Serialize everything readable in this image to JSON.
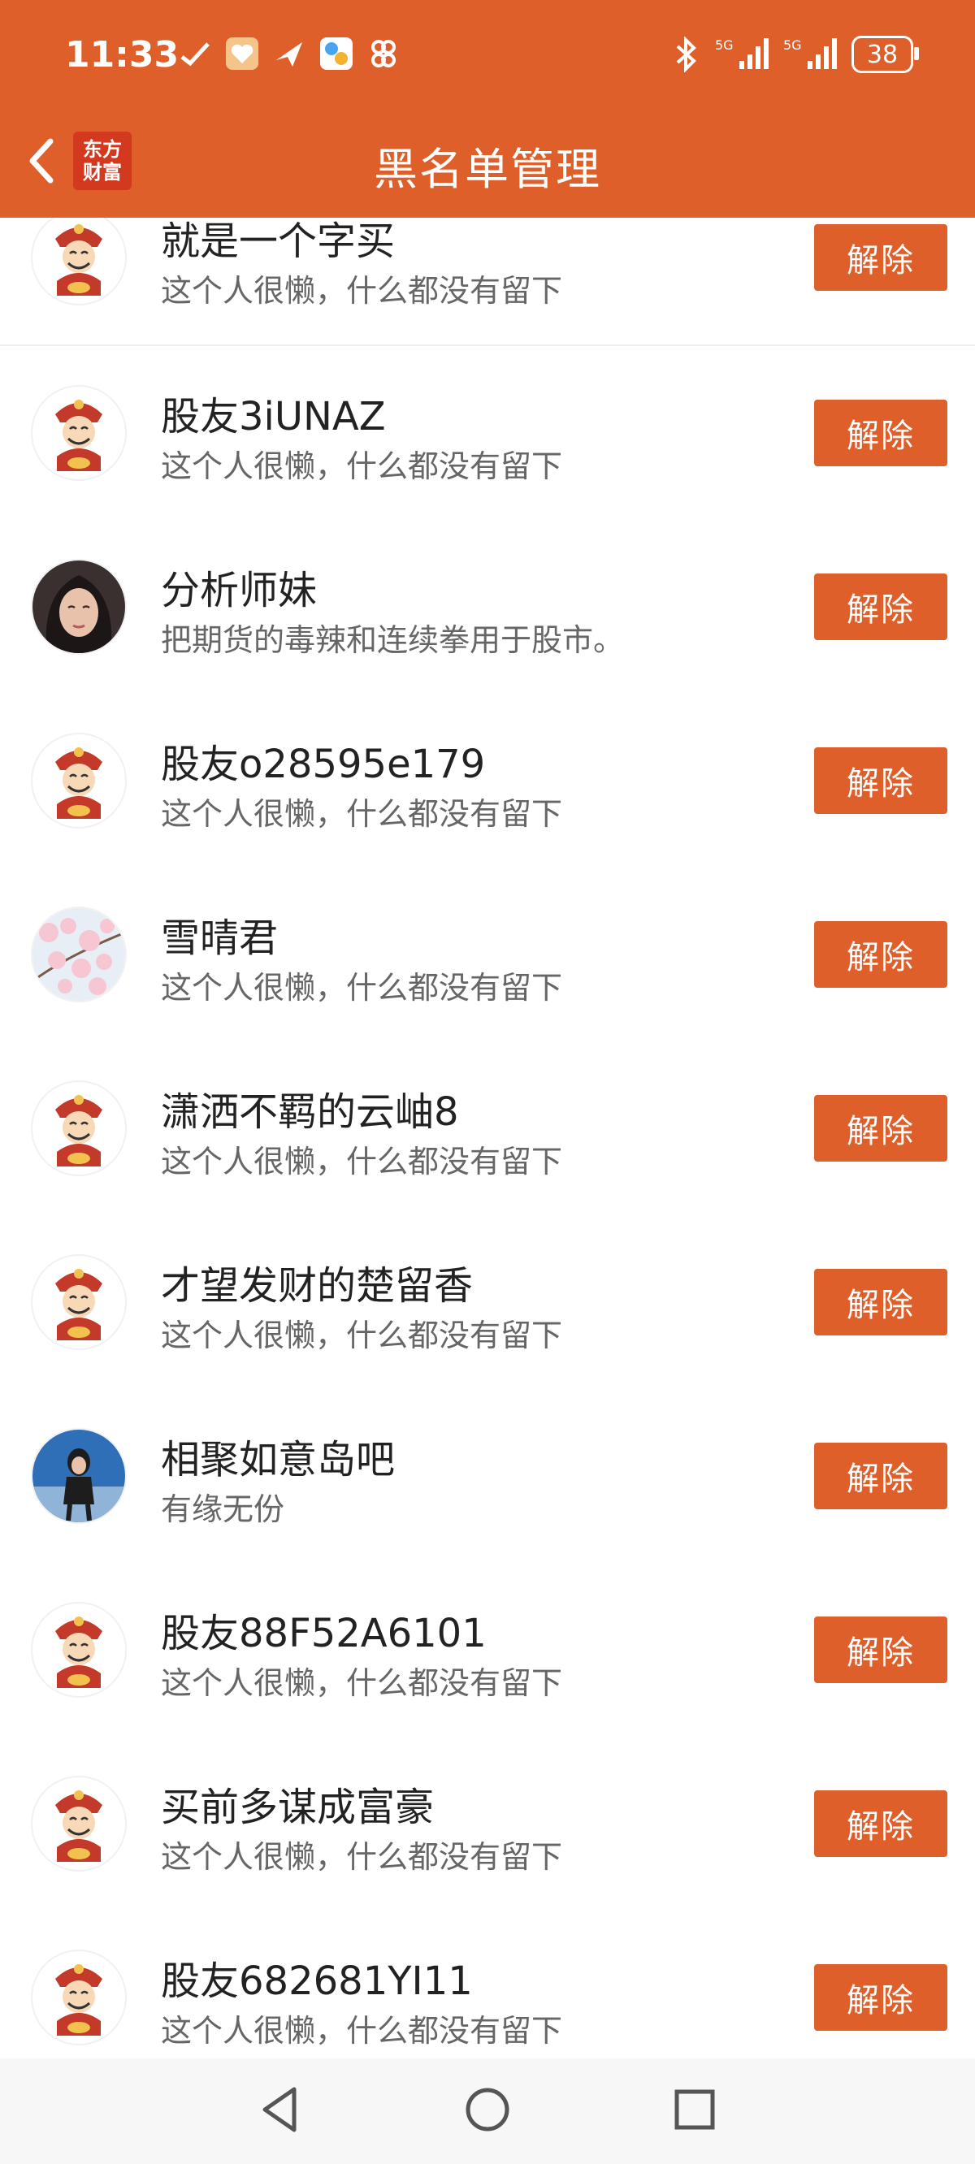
{
  "status": {
    "time": "11:33",
    "battery": "38",
    "network1": "5G",
    "network2": "5G"
  },
  "header": {
    "title": "黑名单管理",
    "logo_line1": "东方",
    "logo_line2": "财富"
  },
  "unblock_label": "解除",
  "users": [
    {
      "name": "就是一个字买",
      "bio": "这个人很懒，什么都没有留下",
      "avatar": "caishen"
    },
    {
      "name": "股友3iUNAZ",
      "bio": "这个人很懒，什么都没有留下",
      "avatar": "caishen"
    },
    {
      "name": "分析师妹",
      "bio": "把期货的毒辣和连续拳用于股市。",
      "avatar": "photo-woman"
    },
    {
      "name": "股友o28595e179",
      "bio": "这个人很懒，什么都没有留下",
      "avatar": "caishen"
    },
    {
      "name": "雪晴君",
      "bio": "这个人很懒，什么都没有留下",
      "avatar": "photo-blossom"
    },
    {
      "name": "潇洒不羁的云岫8",
      "bio": "这个人很懒，什么都没有留下",
      "avatar": "caishen"
    },
    {
      "name": "才望发财的楚留香",
      "bio": "这个人很懒，什么都没有留下",
      "avatar": "caishen"
    },
    {
      "name": "相聚如意岛吧",
      "bio": "有缘无份",
      "avatar": "photo-girl"
    },
    {
      "name": "股友88F52A6101",
      "bio": "这个人很懒，什么都没有留下",
      "avatar": "caishen"
    },
    {
      "name": "买前多谋成富豪",
      "bio": "这个人很懒，什么都没有留下",
      "avatar": "caishen"
    },
    {
      "name": "股友682681YI11",
      "bio": "这个人很懒，什么都没有留下",
      "avatar": "caishen"
    }
  ]
}
